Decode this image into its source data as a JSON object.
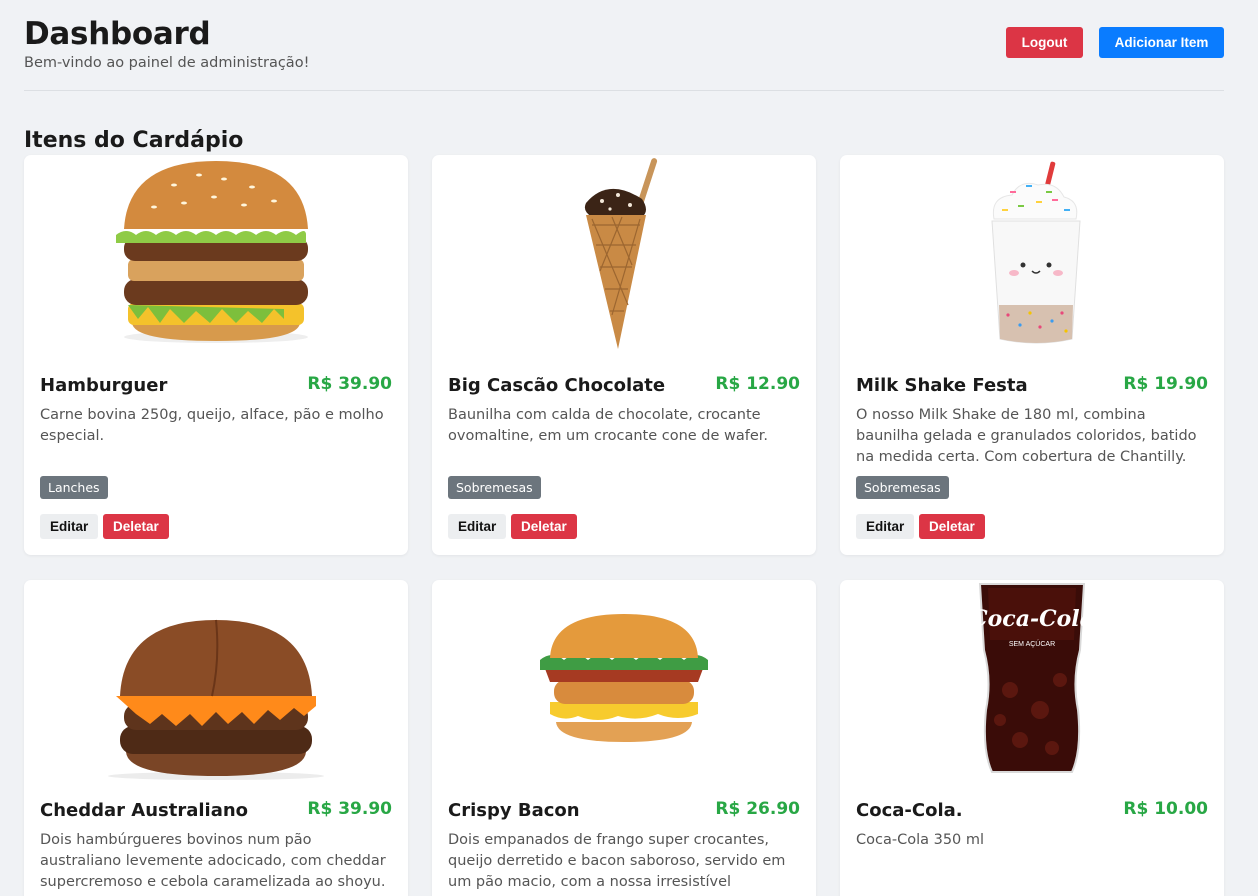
{
  "header": {
    "title": "Dashboard",
    "subtitle": "Bem-vindo ao painel de administração!",
    "logout_label": "Logout",
    "add_label": "Adicionar Item"
  },
  "section": {
    "title": "Itens do Cardápio"
  },
  "colors": {
    "primary": "#0a7cff",
    "danger": "#dc3545",
    "price": "#28a745",
    "badge": "#6c757d"
  },
  "items": [
    {
      "name": "Hamburguer",
      "price": "R$ 39.90",
      "description": "Carne bovina 250g, queijo, alface, pão e molho especial.",
      "category": "Lanches",
      "edit_label": "Editar",
      "delete_label": "Deletar",
      "image": "burger"
    },
    {
      "name": "Big Cascão Chocolate",
      "price": "R$ 12.90",
      "description": "Baunilha com calda de chocolate, crocante ovomaltine, em um crocante cone de wafer.",
      "category": "Sobremesas",
      "edit_label": "Editar",
      "delete_label": "Deletar",
      "image": "ice-cream-cone"
    },
    {
      "name": "Milk Shake Festa",
      "price": "R$ 19.90",
      "description": "O nosso Milk Shake de 180 ml, combina baunilha gelada e granulados coloridos, batido na medida certa. Com cobertura de Chantilly.",
      "category": "Sobremesas",
      "edit_label": "Editar",
      "delete_label": "Deletar",
      "image": "milkshake"
    },
    {
      "name": "Cheddar Australiano",
      "price": "R$ 39.90",
      "description": "Dois hambúrgueres bovinos num pão australiano levemente adocicado, com cheddar supercremoso e cebola caramelizada ao shoyu.",
      "image": "cheddar-burger"
    },
    {
      "name": "Crispy Bacon",
      "price": "R$ 26.90",
      "description": "Dois empanados de frango super crocantes, queijo derretido e bacon saboroso, servido em um pão macio, com a nossa irresistível maionese",
      "image": "chicken-sandwich"
    },
    {
      "name": "Coca-Cola.",
      "price": "R$ 10.00",
      "description": "Coca-Cola 350 ml",
      "image": "soda-glass",
      "image_logo_text": "Coca-Cola",
      "image_caption_text": "SEM AÇÚCAR"
    }
  ]
}
